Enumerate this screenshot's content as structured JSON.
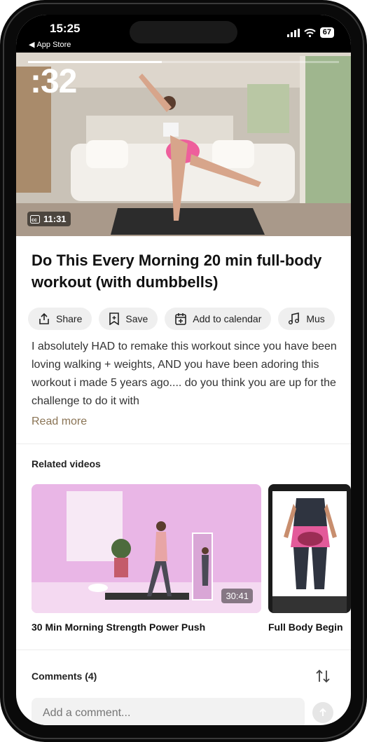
{
  "status_bar": {
    "time": "15:25",
    "back_app": "App Store",
    "battery": "67"
  },
  "video": {
    "countdown": ":32",
    "duration": "11:31",
    "progress": 0.43
  },
  "video_title": "Do This Every Morning 20 min full-body workout (with dumbbells)",
  "actions": [
    {
      "label": "Share",
      "icon": "share-icon"
    },
    {
      "label": "Save",
      "icon": "bookmark-icon"
    },
    {
      "label": "Add to calendar",
      "icon": "calendar-add-icon"
    },
    {
      "label": "Mus",
      "icon": "music-note-icon"
    }
  ],
  "description": "I absolutely HAD to remake this workout since you have been loving walking + weights, AND you have been adoring this workout i made 5 years ago.... do you think you are up for the challenge to do it with",
  "read_more": "Read more",
  "related": {
    "heading": "Related videos",
    "items": [
      {
        "title": "30 Min Morning Strength Power Push",
        "duration": "30:41"
      },
      {
        "title": "Full Body Begin"
      }
    ]
  },
  "comments": {
    "heading": "Comments (4)",
    "placeholder": "Add a comment..."
  },
  "colors": {
    "accent_read_more": "#8a7455",
    "chip_bg": "#efefef"
  }
}
